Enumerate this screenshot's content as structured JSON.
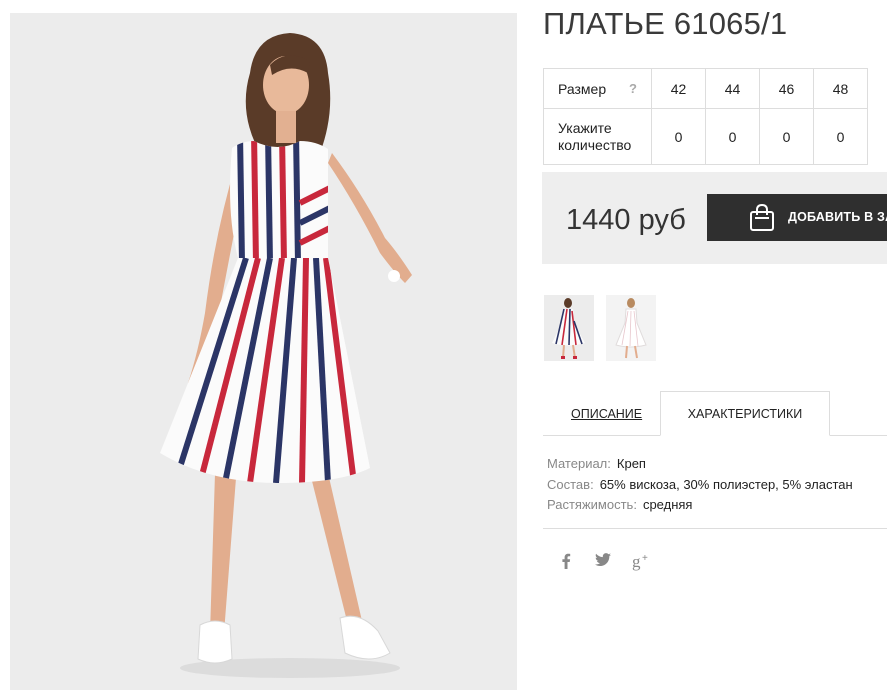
{
  "product": {
    "title": "ПЛАТЬЕ 61065/1",
    "price": "1440 руб",
    "add_to_cart_label": "ДОБАВИТЬ В ЗАКАЗ"
  },
  "size_table": {
    "size_label": "Размер",
    "help_symbol": "?",
    "qty_label_line1": "Укажите",
    "qty_label_line2": "количество",
    "sizes": [
      "42",
      "44",
      "46",
      "48"
    ],
    "quantities": [
      "0",
      "0",
      "0",
      "0"
    ]
  },
  "tabs": {
    "description": "ОПИСАНИЕ",
    "characteristics": "ХАРАКТЕРИСТИКИ",
    "active": "characteristics"
  },
  "specs": [
    {
      "key": "Материал:",
      "value": "Креп"
    },
    {
      "key": "Состав:",
      "value": "65% вискоза, 30% полиэстер, 5% эластан"
    },
    {
      "key": "Растяжимость:",
      "value": "средняя"
    }
  ],
  "social": {
    "facebook": "f",
    "twitter": "twitter-icon",
    "google_plus": "g+"
  },
  "colors": {
    "button_bg": "#2f2f2f",
    "price_box_bg": "#eeeeee",
    "stripe_navy": "#2b3566",
    "stripe_red": "#c8283c"
  }
}
